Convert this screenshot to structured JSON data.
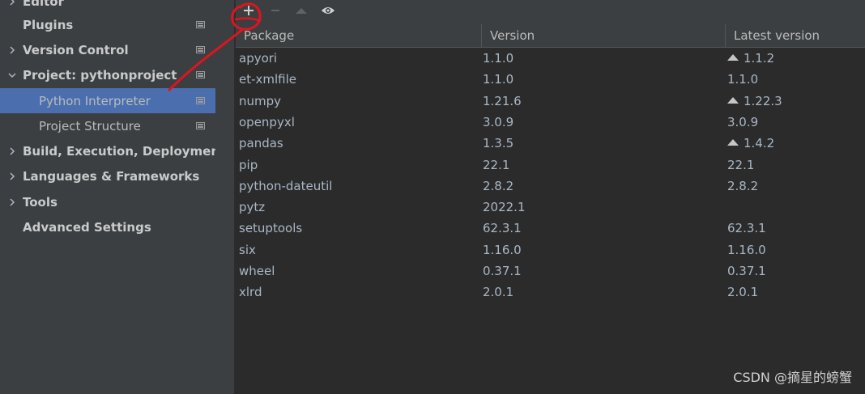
{
  "sidebar": {
    "items": [
      {
        "label": "Editor",
        "bold": true,
        "chevron": "right",
        "icon": false
      },
      {
        "label": "Plugins",
        "bold": true,
        "chevron": null,
        "icon": true
      },
      {
        "label": "Version Control",
        "bold": true,
        "chevron": "right",
        "icon": true
      },
      {
        "label": "Project: pythonproject",
        "bold": true,
        "chevron": "down",
        "icon": true
      },
      {
        "label": "Python Interpreter",
        "bold": false,
        "chevron": null,
        "icon": true,
        "selected": true,
        "indent": true
      },
      {
        "label": "Project Structure",
        "bold": false,
        "chevron": null,
        "icon": true,
        "indent": true
      },
      {
        "label": "Build, Execution, Deployment",
        "bold": true,
        "chevron": "right",
        "icon": false
      },
      {
        "label": "Languages & Frameworks",
        "bold": true,
        "chevron": "right",
        "icon": false
      },
      {
        "label": "Tools",
        "bold": true,
        "chevron": "right",
        "icon": false
      },
      {
        "label": "Advanced Settings",
        "bold": true,
        "chevron": null,
        "icon": false
      }
    ]
  },
  "toolbar": {
    "add_icon": "plus-icon",
    "remove_icon": "minus-icon",
    "upgrade_icon": "triangle-up-icon",
    "show_icon": "eye-icon"
  },
  "table": {
    "headers": {
      "package": "Package",
      "version": "Version",
      "latest": "Latest version"
    },
    "rows": [
      {
        "name": "apyori",
        "version": "1.1.0",
        "latest": "1.1.2",
        "upgrade": true
      },
      {
        "name": "et-xmlfile",
        "version": "1.1.0",
        "latest": "1.1.0",
        "upgrade": false
      },
      {
        "name": "numpy",
        "version": "1.21.6",
        "latest": "1.22.3",
        "upgrade": true
      },
      {
        "name": "openpyxl",
        "version": "3.0.9",
        "latest": "3.0.9",
        "upgrade": false
      },
      {
        "name": "pandas",
        "version": "1.3.5",
        "latest": "1.4.2",
        "upgrade": true
      },
      {
        "name": "pip",
        "version": "22.1",
        "latest": "22.1",
        "upgrade": false
      },
      {
        "name": "python-dateutil",
        "version": "2.8.2",
        "latest": "2.8.2",
        "upgrade": false
      },
      {
        "name": "pytz",
        "version": "2022.1",
        "latest": "",
        "upgrade": false
      },
      {
        "name": "setuptools",
        "version": "62.3.1",
        "latest": "62.3.1",
        "upgrade": false
      },
      {
        "name": "six",
        "version": "1.16.0",
        "latest": "1.16.0",
        "upgrade": false
      },
      {
        "name": "wheel",
        "version": "0.37.1",
        "latest": "0.37.1",
        "upgrade": false
      },
      {
        "name": "xlrd",
        "version": "2.0.1",
        "latest": "2.0.1",
        "upgrade": false
      }
    ]
  },
  "watermark": "CSDN @摘星的螃蟹",
  "colors": {
    "selection": "#4b6eaf",
    "annotation": "#e0141e"
  }
}
